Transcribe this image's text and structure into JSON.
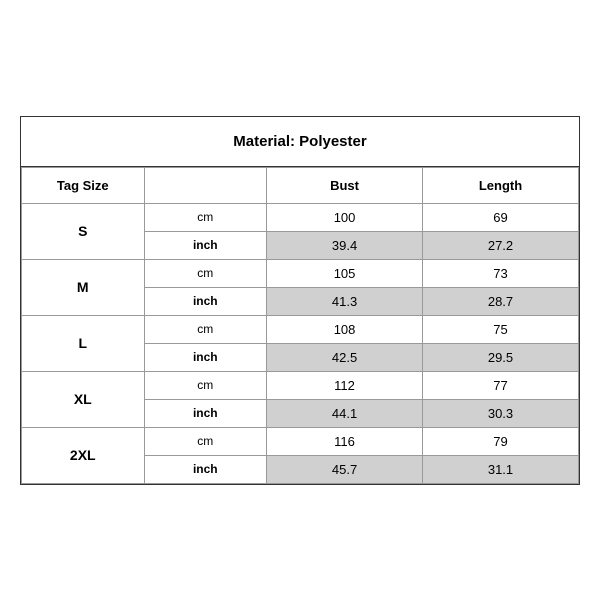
{
  "title": "Material: Polyester",
  "headers": {
    "tag_size": "Tag Size",
    "bust": "Bust",
    "length": "Length"
  },
  "sizes": [
    {
      "label": "S",
      "cm": {
        "bust": "100",
        "length": "69"
      },
      "inch": {
        "bust": "39.4",
        "length": "27.2"
      }
    },
    {
      "label": "M",
      "cm": {
        "bust": "105",
        "length": "73"
      },
      "inch": {
        "bust": "41.3",
        "length": "28.7"
      }
    },
    {
      "label": "L",
      "cm": {
        "bust": "108",
        "length": "75"
      },
      "inch": {
        "bust": "42.5",
        "length": "29.5"
      }
    },
    {
      "label": "XL",
      "cm": {
        "bust": "112",
        "length": "77"
      },
      "inch": {
        "bust": "44.1",
        "length": "30.3"
      }
    },
    {
      "label": "2XL",
      "cm": {
        "bust": "116",
        "length": "79"
      },
      "inch": {
        "bust": "45.7",
        "length": "31.1"
      }
    }
  ],
  "unit_labels": {
    "cm": "cm",
    "inch": "inch"
  }
}
